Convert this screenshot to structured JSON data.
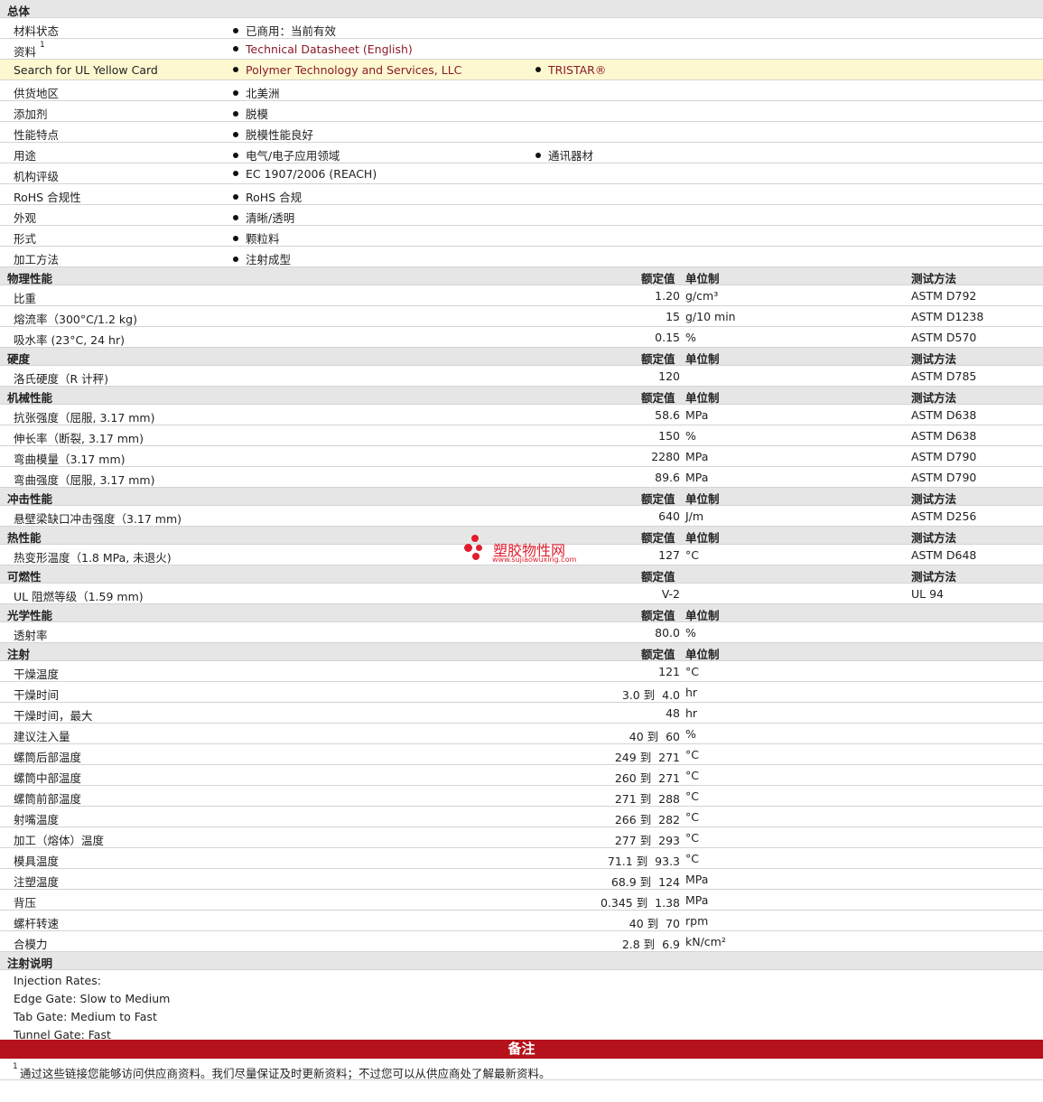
{
  "general": {
    "section": "总体",
    "rows": [
      {
        "label": "材料状态",
        "b1": "已商用：当前有效",
        "b2": ""
      },
      {
        "label": "资料",
        "sup": "1",
        "b1": "Technical Datasheet (English)",
        "b2": "",
        "link1": true
      },
      {
        "label": "Search for UL Yellow Card",
        "b1": "Polymer Technology and Services, LLC",
        "b2": "TRISTAR®",
        "link1": true,
        "link2": true,
        "highlight": true
      },
      {
        "label": "供货地区",
        "b1": "北美洲",
        "b2": ""
      },
      {
        "label": "添加剂",
        "b1": "脱模",
        "b2": ""
      },
      {
        "label": "性能特点",
        "b1": "脱模性能良好",
        "b2": ""
      },
      {
        "label": "用途",
        "b1": "电气/电子应用领域",
        "b2": "通讯器材"
      },
      {
        "label": "机构评级",
        "b1": "EC 1907/2006 (REACH)",
        "b2": ""
      },
      {
        "label": "RoHS 合规性",
        "b1": "RoHS 合规",
        "b2": ""
      },
      {
        "label": "外观",
        "b1": "清晰/透明",
        "b2": ""
      },
      {
        "label": "形式",
        "b1": "颗粒料",
        "b2": ""
      },
      {
        "label": "加工方法",
        "b1": "注射成型",
        "b2": ""
      }
    ]
  },
  "col_nominal": "额定值",
  "col_unit": "单位制",
  "col_method": "测试方法",
  "sections": [
    {
      "title": "物理性能",
      "unit_col": true,
      "method_col": true,
      "rows": [
        {
          "label": "比重",
          "value": "1.20",
          "unit": "g/cm³",
          "method": "ASTM D792"
        },
        {
          "label": "熔流率（300°C/1.2 kg)",
          "value": "15",
          "unit": "g/10 min",
          "method": "ASTM D1238"
        },
        {
          "label": "吸水率 (23°C, 24 hr)",
          "value": "0.15",
          "unit": "%",
          "method": "ASTM D570"
        }
      ]
    },
    {
      "title": "硬度",
      "unit_col": true,
      "method_col": true,
      "rows": [
        {
          "label": "洛氏硬度（R 计秤)",
          "value": "120",
          "unit": "",
          "method": "ASTM D785"
        }
      ]
    },
    {
      "title": "机械性能",
      "unit_col": true,
      "method_col": true,
      "rows": [
        {
          "label": "抗张强度（屈服, 3.17 mm)",
          "value": "58.6",
          "unit": "MPa",
          "method": "ASTM D638"
        },
        {
          "label": "伸长率（断裂, 3.17 mm)",
          "value": "150",
          "unit": "%",
          "method": "ASTM D638"
        },
        {
          "label": "弯曲模量（3.17 mm)",
          "value": "2280",
          "unit": "MPa",
          "method": "ASTM D790"
        },
        {
          "label": "弯曲强度（屈服, 3.17 mm)",
          "value": "89.6",
          "unit": "MPa",
          "method": "ASTM D790"
        }
      ]
    },
    {
      "title": "冲击性能",
      "unit_col": true,
      "method_col": true,
      "rows": [
        {
          "label": "悬壁梁缺口冲击强度（3.17 mm)",
          "value": "640",
          "unit": "J/m",
          "method": "ASTM D256"
        }
      ]
    },
    {
      "title": "热性能",
      "unit_col": true,
      "method_col": true,
      "rows": [
        {
          "label": "热变形温度（1.8 MPa, 未退火)",
          "value": "127",
          "unit": "°C",
          "method": "ASTM D648"
        }
      ]
    },
    {
      "title": "可燃性",
      "unit_col": false,
      "method_col": true,
      "rows": [
        {
          "label": "UL 阻燃等级（1.59 mm)",
          "value": "V-2",
          "unit": "",
          "method": "UL 94"
        }
      ]
    },
    {
      "title": "光学性能",
      "unit_col": true,
      "method_col": false,
      "rows": [
        {
          "label": "透射率",
          "value": "80.0",
          "unit": "%",
          "method": ""
        }
      ]
    },
    {
      "title": "注射",
      "unit_col": true,
      "method_col": false,
      "rows": [
        {
          "label": "干燥温度",
          "value": "121",
          "unit": "°C",
          "method": ""
        },
        {
          "label": "干燥时间",
          "value": "3.0 到  4.0",
          "unit": "hr",
          "method": ""
        },
        {
          "label": "干燥时间，最大",
          "value": "48",
          "unit": "hr",
          "method": ""
        },
        {
          "label": "建议注入量",
          "value": "40 到  60",
          "unit": "%",
          "method": ""
        },
        {
          "label": "螺筒后部温度",
          "value": "249 到  271",
          "unit": "°C",
          "method": ""
        },
        {
          "label": "螺筒中部温度",
          "value": "260 到  271",
          "unit": "°C",
          "method": ""
        },
        {
          "label": "螺筒前部温度",
          "value": "271 到  288",
          "unit": "°C",
          "method": ""
        },
        {
          "label": "射嘴温度",
          "value": "266 到  282",
          "unit": "°C",
          "method": ""
        },
        {
          "label": "加工（熔体）温度",
          "value": "277 到  293",
          "unit": "°C",
          "method": ""
        },
        {
          "label": "模具温度",
          "value": "71.1 到  93.3",
          "unit": "°C",
          "method": ""
        },
        {
          "label": "注塑温度",
          "value": "68.9 到  124",
          "unit": "MPa",
          "method": ""
        },
        {
          "label": "背压",
          "value": "0.345 到  1.38",
          "unit": "MPa",
          "method": ""
        },
        {
          "label": "螺杆转速",
          "value": "40 到  70",
          "unit": "rpm",
          "method": ""
        },
        {
          "label": "合模力",
          "value": "2.8 到  6.9",
          "unit": "kN/cm²",
          "method": ""
        }
      ]
    }
  ],
  "injection_notes": {
    "title": "注射说明",
    "lines": [
      "Injection Rates:",
      "Edge Gate: Slow to Medium",
      "Tab Gate: Medium to Fast",
      "Tunnel Gate: Fast"
    ]
  },
  "remarks": {
    "title": "备注",
    "sup": "1",
    "text": "通过这些链接您能够访问供应商资料。我们尽量保证及时更新资料；不过您可以从供应商处了解最新资料。"
  },
  "watermark": {
    "name": "塑胶物性网",
    "url": "www.sujiaowuxing.com"
  },
  "colors": {
    "header_bg": "#e6e6e6",
    "highlight_bg": "#fdf8d0",
    "link": "#8b1a2b",
    "banner": "#b5121b",
    "watermark": "#e21c2c"
  }
}
